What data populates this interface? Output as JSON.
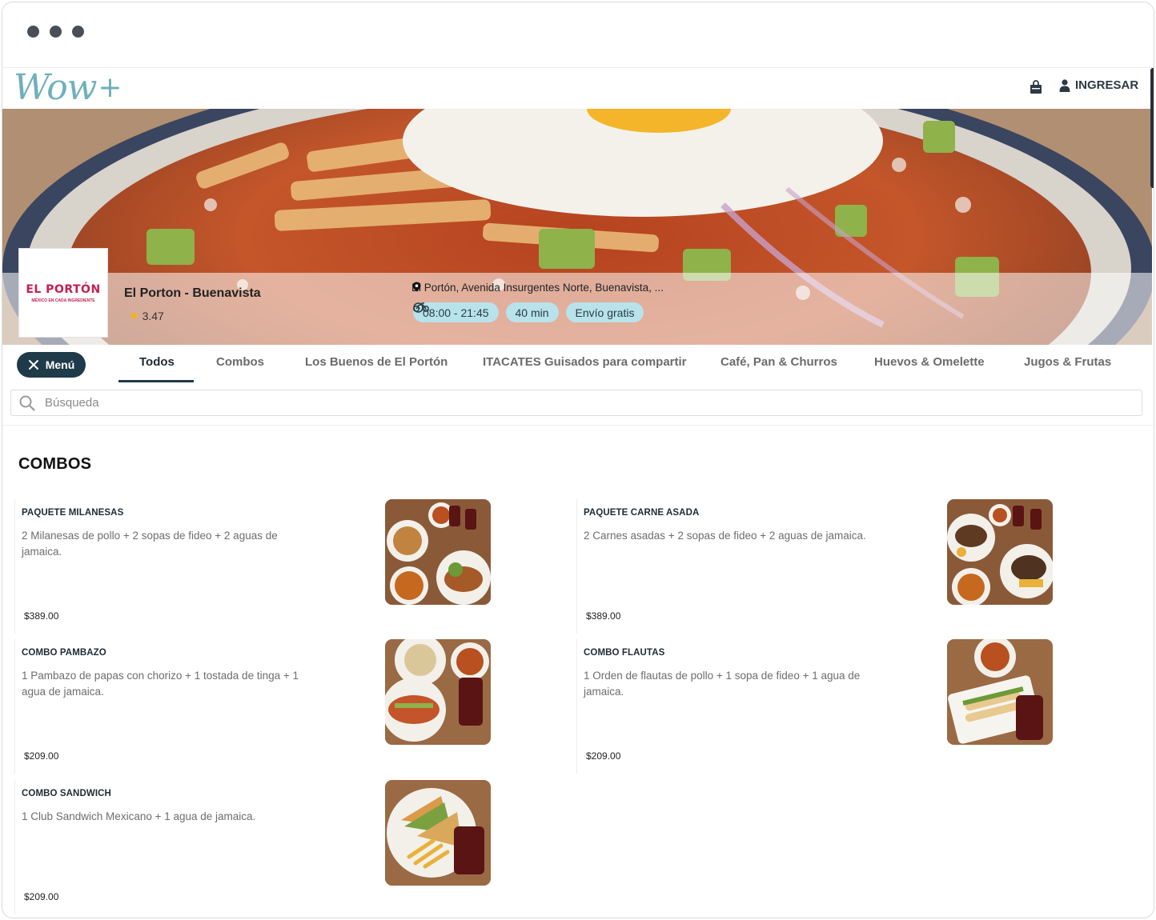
{
  "header": {
    "logo_text": "Wow",
    "logo_plus": "+",
    "cart_icon": "shopping-bag-icon",
    "login_label": "INGRESAR"
  },
  "store": {
    "logo_brand": "EL PORTÓN",
    "logo_tagline": "MÉXICO EN CADA INGREDIENTE",
    "name": "El Porton - Buenavista",
    "rating": "3.47",
    "address": "El Portón, Avenida Insurgentes Norte, Buenavista, ...",
    "hours": "08:00 - 21:45",
    "delivery_time": "40 min",
    "shipping": "Envío gratis"
  },
  "nav": {
    "menu_label": "Menú",
    "tabs": [
      {
        "label": "Todos"
      },
      {
        "label": "Combos"
      },
      {
        "label": "Los Buenos de El Portón"
      },
      {
        "label": "ITACATES Guisados para compartir"
      },
      {
        "label": "Café, Pan & Churros"
      },
      {
        "label": "Huevos & Omelette"
      },
      {
        "label": "Jugos & Frutas"
      }
    ]
  },
  "search": {
    "placeholder": "Búsqueda"
  },
  "section": {
    "title": "COMBOS",
    "items": [
      {
        "name": "PAQUETE MILANESAS",
        "description": "2 Milanesas de pollo + 2 sopas de fideo + 2 aguas de jamaica.",
        "price": "$389.00"
      },
      {
        "name": "PAQUETE CARNE ASADA",
        "description": "2 Carnes asadas + 2 sopas de fideo + 2 aguas de jamaica.",
        "price": "$389.00"
      },
      {
        "name": "COMBO PAMBAZO",
        "description": "1 Pambazo de papas con chorizo + 1 tostada de tinga + 1 agua de jamaica.",
        "price": "$209.00"
      },
      {
        "name": "COMBO FLAUTAS",
        "description": "1 Orden de flautas de pollo + 1 sopa de fideo + 1 agua de jamaica.",
        "price": "$209.00"
      },
      {
        "name": "COMBO SANDWICH",
        "description": "1 Club Sandwich Mexicano + 1 agua de jamaica.",
        "price": "$209.00"
      }
    ]
  },
  "colors": {
    "accent": "#1f3a49",
    "pill_bg": "#b8e3ea",
    "logo_teal": "#6fb0bb",
    "brand_red": "#c21f4f"
  }
}
